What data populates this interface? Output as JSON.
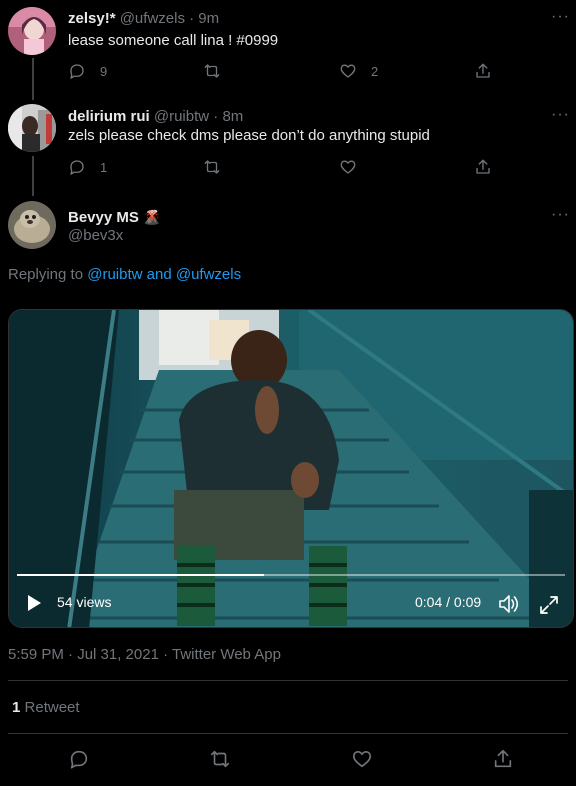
{
  "tweets": [
    {
      "name": "zelsy!*",
      "handle": "@ufwzels",
      "sep": "·",
      "time": "9m",
      "text": "lease someone call lina ! #0999",
      "reply_count": "9",
      "retweet_count": "",
      "like_count": "2",
      "more": "···"
    },
    {
      "name": "delirium rui",
      "handle": "@ruibtw",
      "sep": "·",
      "time": "8m",
      "text": "zels please check dms please don’t do anything stupid",
      "reply_count": "1",
      "retweet_count": "",
      "like_count": "",
      "more": "···"
    }
  ],
  "main_tweet": {
    "name": "Bevyy MS",
    "name_emoji": "🌋",
    "handle": "@bev3x",
    "more": "···",
    "replying_prefix": "Replying to",
    "replying_user1": "@ruibtw",
    "replying_and": "and",
    "replying_user2": "@ufwzels",
    "video": {
      "views": "54 views",
      "time": "0:04 / 0:09",
      "progress": 0.45
    },
    "timestamp": "5:59 PM · Jul 31, 2021 · Twitter Web App",
    "retweet_count": "1",
    "retweet_label": "Retweet"
  },
  "colors": {
    "background": "#000000",
    "text": "#e7e9ea",
    "secondary": "#71767b",
    "link": "#1d9bf0",
    "divider": "#2f3336"
  },
  "icons": {
    "reply": "reply-icon",
    "retweet": "retweet-icon",
    "like": "like-icon",
    "share": "share-icon",
    "play": "play-icon",
    "volume": "volume-icon",
    "fullscreen": "fullscreen-icon",
    "more": "more-icon"
  }
}
